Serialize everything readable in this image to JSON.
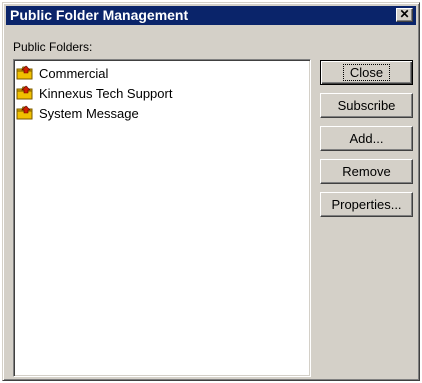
{
  "window": {
    "title": "Public Folder Management",
    "close_glyph": "✕"
  },
  "folders": {
    "label": "Public Folders:",
    "items": [
      {
        "label": "Commercial",
        "icon": "public-folder-icon"
      },
      {
        "label": "Kinnexus Tech Support",
        "icon": "public-folder-icon"
      },
      {
        "label": "System Message",
        "icon": "public-folder-icon"
      }
    ]
  },
  "buttons": {
    "close": "Close",
    "subscribe": "Subscribe",
    "add": "Add...",
    "remove": "Remove",
    "properties": "Properties..."
  },
  "colors": {
    "title_bar": "#0a246a",
    "face": "#d4d0c8",
    "folder_yellow": "#f0c000",
    "folder_badge": "#d02000"
  }
}
